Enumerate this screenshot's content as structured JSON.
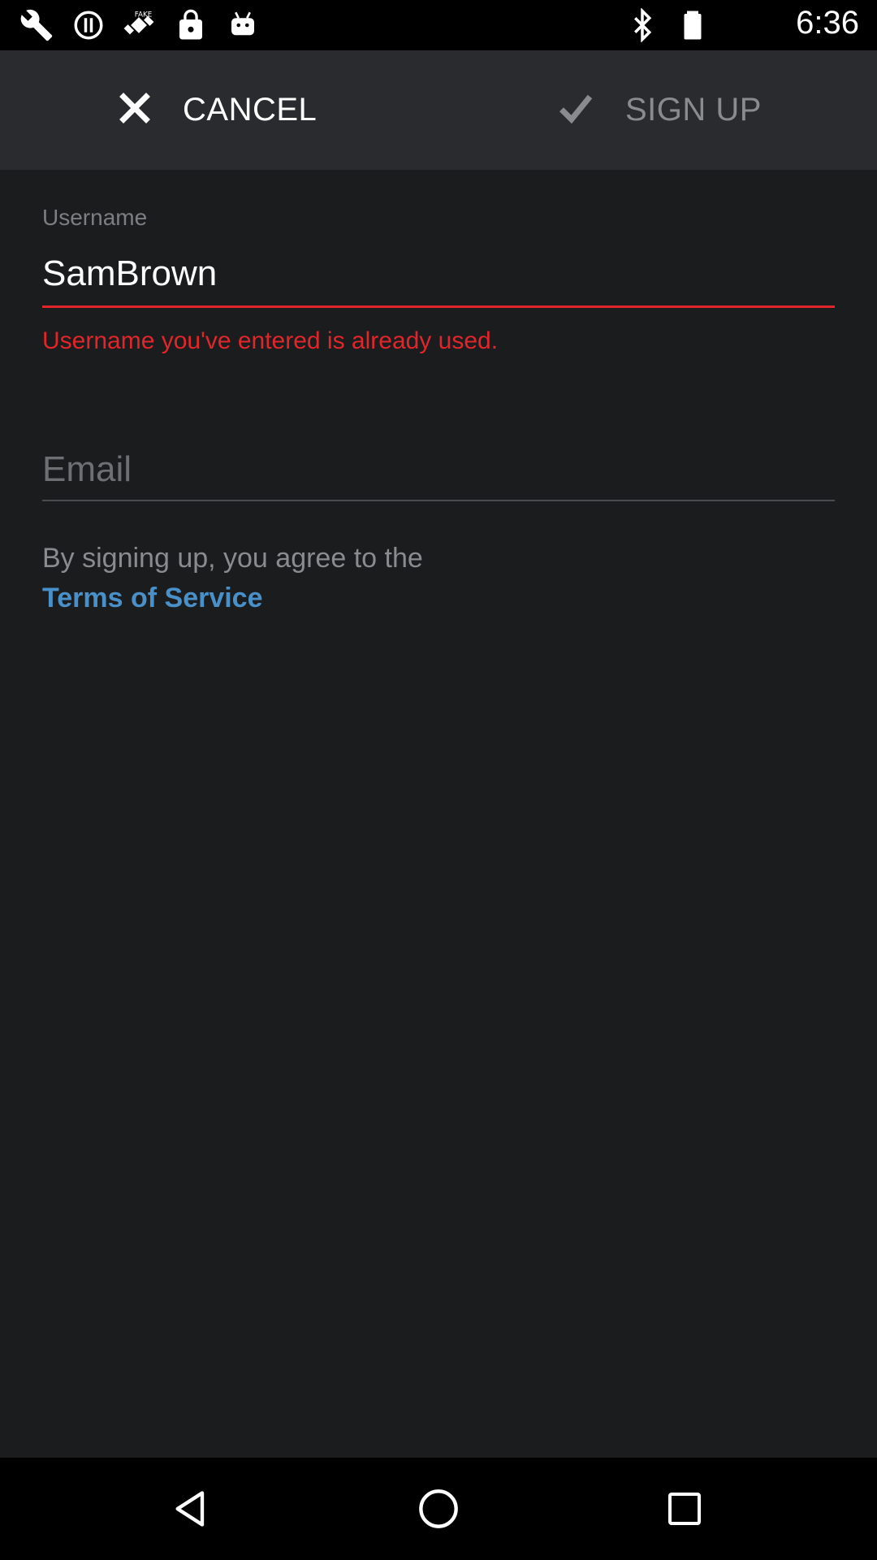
{
  "status_bar": {
    "time": "6:36",
    "icons": [
      "wrench-icon",
      "sync-icon",
      "fake-gps-icon",
      "lock-icon",
      "android-icon",
      "bluetooth-icon",
      "battery-icon"
    ]
  },
  "action_bar": {
    "cancel_label": "CANCEL",
    "signup_label": "SIGN UP"
  },
  "form": {
    "username_label": "Username",
    "username_value": "SamBrown",
    "username_error": "Username you've entered is already used.",
    "email_placeholder": "Email",
    "email_value": "",
    "agree_text": "By signing up, you agree to the",
    "terms_link": "Terms of Service"
  },
  "colors": {
    "background": "#1b1c1e",
    "action_bar": "#2a2b2e",
    "error": "#e0262a",
    "link": "#4a90c8"
  },
  "nav_bar": {
    "icons": [
      "back-icon",
      "home-icon",
      "recents-icon"
    ]
  }
}
